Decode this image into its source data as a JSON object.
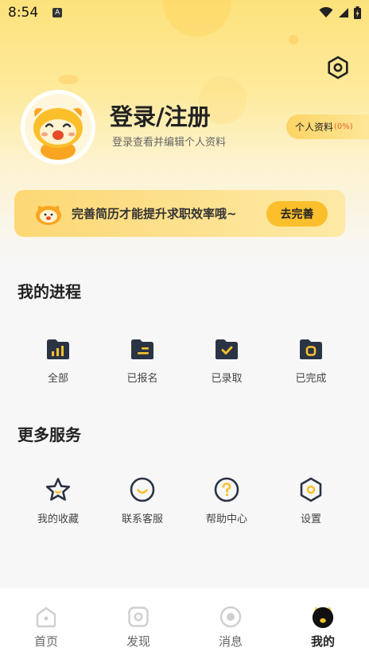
{
  "status_bar": {
    "time": "8:54",
    "indicator": "A"
  },
  "header": {
    "title": "登录/注册",
    "subtitle": "登录查看并编辑个人资料",
    "profile_label": "个人资料",
    "profile_percent": "(0%)"
  },
  "banner": {
    "text": "完善简历才能提升求职效率哦~",
    "button_label": "去完善"
  },
  "progress": {
    "title": "我的进程",
    "items": [
      {
        "label": "全部",
        "icon": "chart-folder-icon"
      },
      {
        "label": "已报名",
        "icon": "signed-folder-icon"
      },
      {
        "label": "已录取",
        "icon": "check-folder-icon"
      },
      {
        "label": "已完成",
        "icon": "done-folder-icon"
      }
    ]
  },
  "services": {
    "title": "更多服务",
    "items": [
      {
        "label": "我的收藏",
        "icon": "star-icon"
      },
      {
        "label": "联系客服",
        "icon": "smile-icon"
      },
      {
        "label": "帮助中心",
        "icon": "question-icon"
      },
      {
        "label": "设置",
        "icon": "settings-icon"
      }
    ]
  },
  "tabbar": {
    "tabs": [
      {
        "label": "首页",
        "icon": "home-icon"
      },
      {
        "label": "发现",
        "icon": "discover-icon"
      },
      {
        "label": "消息",
        "icon": "message-icon"
      },
      {
        "label": "我的",
        "icon": "mine-icon",
        "active": true
      }
    ]
  },
  "colors": {
    "accent": "#fcbf2c",
    "header_gradient_top": "#fde27b",
    "icon_dark": "#2b3445",
    "icon_highlight": "#f7c22c"
  }
}
